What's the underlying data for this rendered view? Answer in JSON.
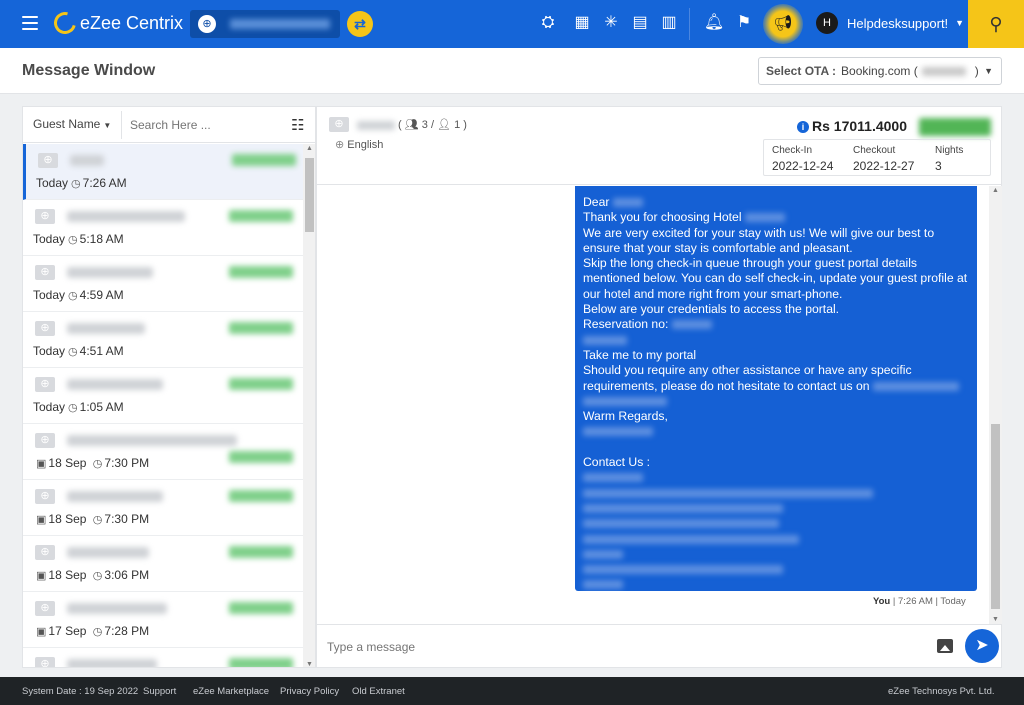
{
  "app": {
    "name": "eZee Centrix",
    "user_initial": "H",
    "user_name": "Helpdesksupport!"
  },
  "page": {
    "title": "Message Window",
    "ota_label": "Select OTA :",
    "ota_value": "Booking.com (",
    "ota_close": ")"
  },
  "list_panel": {
    "filter_label": "Guest Name",
    "search_placeholder": "Search Here ...",
    "items": [
      {
        "date": "Today",
        "time": "7:26 AM",
        "active": true
      },
      {
        "date": "Today",
        "time": "5:18 AM"
      },
      {
        "date": "Today",
        "time": "4:59 AM"
      },
      {
        "date": "Today",
        "time": "4:51 AM"
      },
      {
        "date": "Today",
        "time": "1:05 AM"
      },
      {
        "date": "18 Sep",
        "time": "7:30 PM"
      },
      {
        "date": "18 Sep",
        "time": "7:30 PM"
      },
      {
        "date": "18 Sep",
        "time": "3:06 PM"
      },
      {
        "date": "17 Sep",
        "time": "7:28 PM"
      },
      {
        "date": "",
        "time": ""
      }
    ]
  },
  "conversation": {
    "pax": "3 /",
    "pax_child": "1 )",
    "pax_open": "(",
    "language": "English",
    "amount": "Rs 17011.4000",
    "checkin_label": "Check-In",
    "checkin": "2022-12-24",
    "checkout_label": "Checkout",
    "checkout": "2022-12-27",
    "nights_label": "Nights",
    "nights": "3",
    "message": {
      "dear": "Dear",
      "thanks": "Thank you for choosing Hotel",
      "excited": "We are very excited for your stay with us! We will give our best to ensure that your stay is comfortable and pleasant.",
      "skip": "Skip the long check-in queue through your guest portal details mentioned below. You can do self check-in, update your guest profile at our hotel and more right from your smart-phone.",
      "below": "Below are your credentials to access the portal.",
      "reservation": "Reservation no:",
      "take_me": "Take me to my portal",
      "assist": "Should you require any other assistance or have any specific requirements, please do not hesitate to contact us on",
      "regards": "Warm Regards,",
      "contact": "Contact Us :"
    },
    "sender": "You",
    "sent_time": "| 7:26 AM | Today",
    "composer_placeholder": "Type a message"
  },
  "footer": {
    "system_date": "System Date : 19 Sep 2022",
    "support": "Support",
    "marketplace": "eZee Marketplace",
    "privacy": "Privacy Policy",
    "old_extranet": "Old Extranet",
    "company": "eZee Technosys Pvt. Ltd."
  },
  "colors": {
    "primary": "#1565d8",
    "accent": "#f5c518",
    "bubble": "#1560d4",
    "footer": "#1f2326"
  },
  "icons": [
    "menu-icon",
    "globe-icon",
    "shuffle-icon",
    "housekeeping-icon",
    "calendar-icon",
    "channel-icon",
    "reports-icon",
    "chart-icon",
    "bell-icon",
    "flag-icon",
    "megaphone-icon",
    "search-icon",
    "filter-icon",
    "clock-icon",
    "image-icon",
    "send-icon"
  ]
}
